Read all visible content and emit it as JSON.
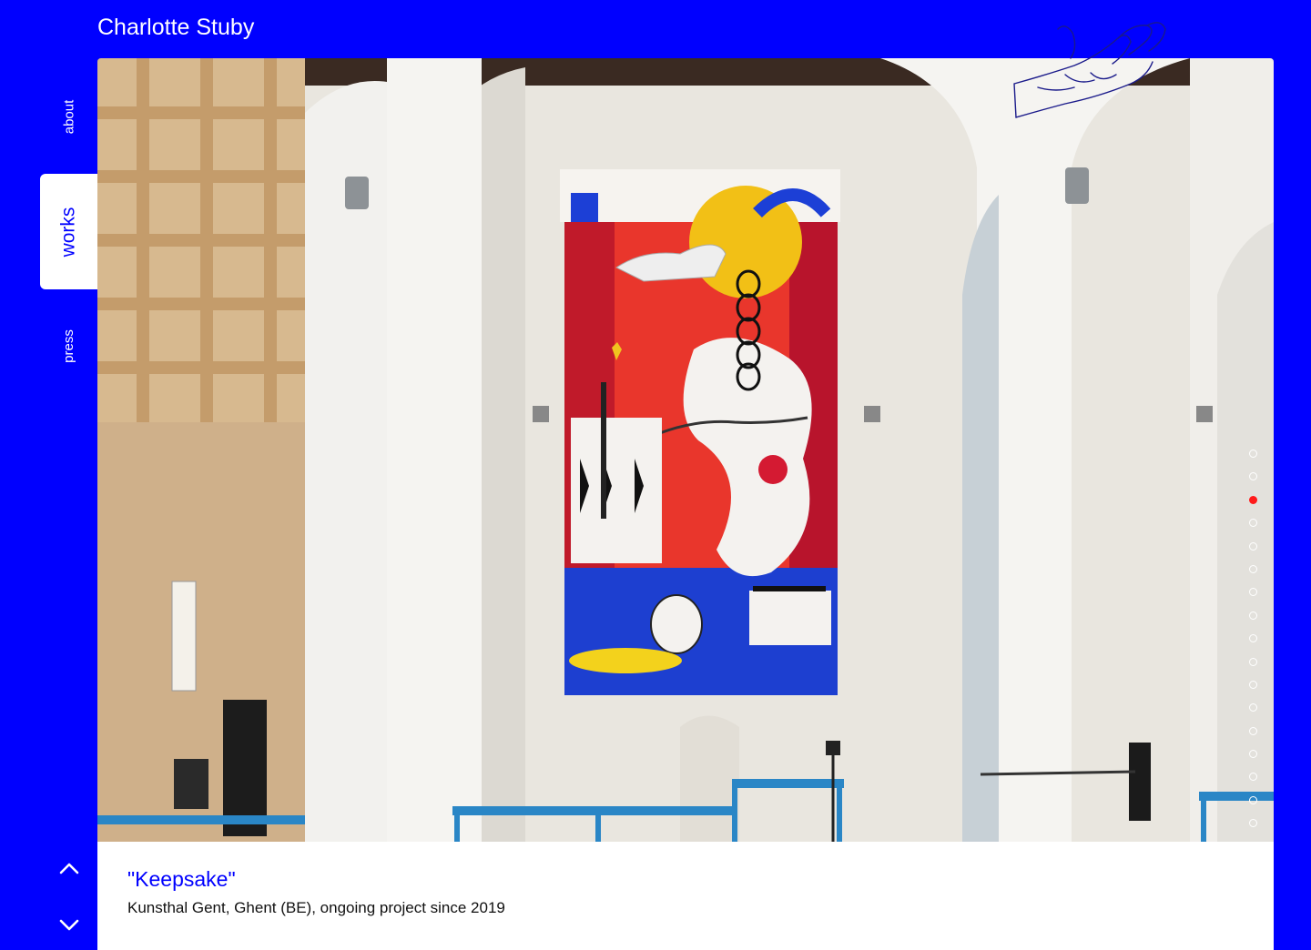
{
  "site": {
    "title": "Charlotte Stuby"
  },
  "nav": {
    "about": "about",
    "works": "works",
    "press": "press"
  },
  "work": {
    "title": "\"Keepsake\"",
    "subtitle": "Kunsthal Gent, Ghent (BE), ongoing project since 2019"
  },
  "slideshow": {
    "total": 17,
    "active_index": 2
  },
  "colors": {
    "background": "#0000ff",
    "accent": "#0000ff",
    "active_dot": "#ff1a1a"
  }
}
